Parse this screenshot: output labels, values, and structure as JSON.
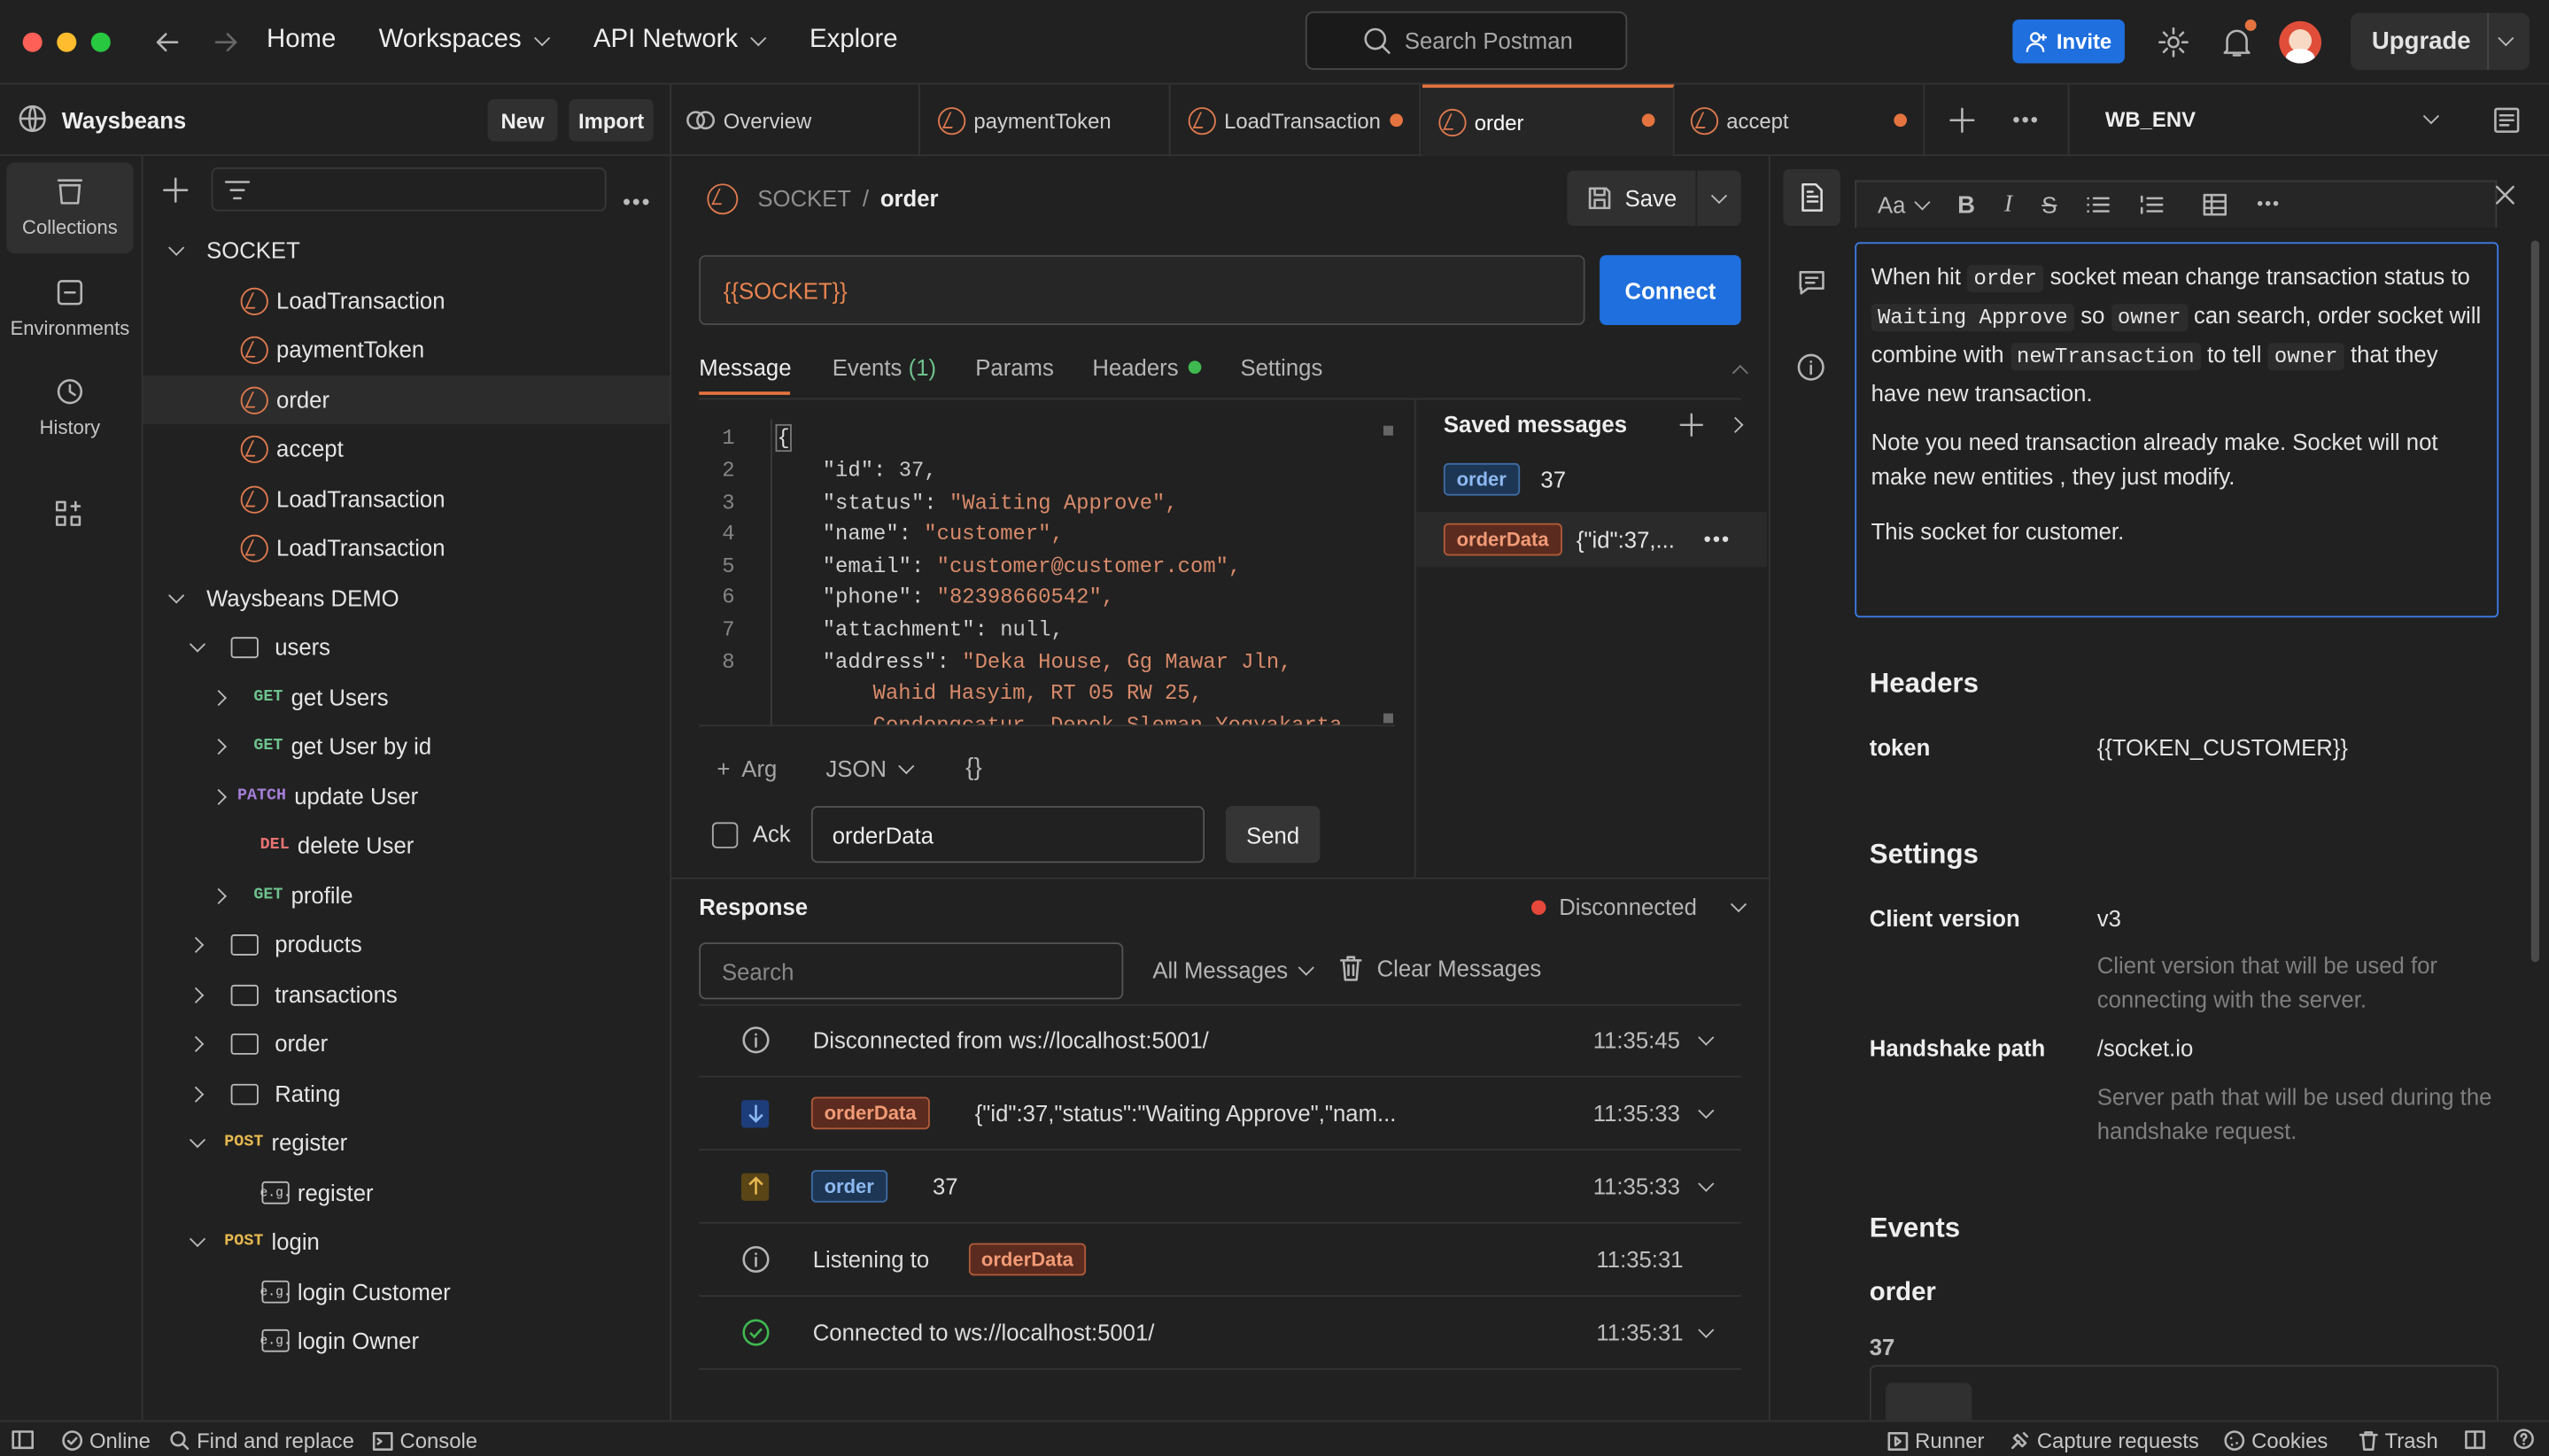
{
  "topbar": {
    "home": "Home",
    "workspaces": "Workspaces",
    "api_network": "API Network",
    "explore": "Explore",
    "search_placeholder": "Search Postman",
    "invite": "Invite",
    "upgrade": "Upgrade"
  },
  "sidebar": {
    "workspace": "Waysbeans",
    "new": "New",
    "import": "Import",
    "rail": [
      "Collections",
      "Environments",
      "History"
    ],
    "items": [
      "SOCKET",
      "LoadTransaction",
      "paymentToken",
      "order",
      "accept",
      "LoadTransaction",
      "LoadTransaction",
      "Waysbeans DEMO",
      "users",
      "get Users",
      "get User by id",
      "update User",
      "delete User",
      "profile",
      "products",
      "transactions",
      "order",
      "Rating",
      "register",
      "register",
      "login",
      "login Customer",
      "login Owner"
    ],
    "methods": {
      "get": "GET",
      "patch": "PATCH",
      "del": "DEL",
      "post": "POST"
    }
  },
  "tabs": [
    "Overview",
    "paymentToken",
    "LoadTransaction",
    "order",
    "accept"
  ],
  "env": "WB_ENV",
  "request": {
    "breadcrumb_root": "SOCKET",
    "breadcrumb_sep": "/",
    "breadcrumb_name": "order",
    "save": "Save",
    "url": "{{SOCKET}}",
    "connect": "Connect",
    "subtabs": [
      "Message",
      "Events",
      "(1)",
      "Params",
      "Headers",
      "Settings"
    ],
    "code": [
      {
        "n": "1",
        "t": "{"
      },
      {
        "n": "2",
        "k": "\"id\"",
        "v": "37,"
      },
      {
        "n": "3",
        "k": "\"status\"",
        "v": "\"Waiting Approve\","
      },
      {
        "n": "4",
        "k": "\"name\"",
        "v": "\"customer\","
      },
      {
        "n": "5",
        "k": "\"email\"",
        "v": "\"customer@customer.com\","
      },
      {
        "n": "6",
        "k": "\"phone\"",
        "v": "\"82398660542\","
      },
      {
        "n": "7",
        "k": "\"attachment\"",
        "v": "null,"
      },
      {
        "n": "8",
        "k": "\"address\"",
        "v": "\"Deka House, Gg Mawar Jln,"
      },
      {
        "n": "",
        "k": "",
        "v": "Wahid Hasyim, RT 05 RW 25,"
      },
      {
        "n": "",
        "k": "",
        "v": "Condongcatur, Depok Sleman Yogyakarta"
      }
    ],
    "arg": "Arg",
    "format": "JSON",
    "braces": "{}",
    "ack": "Ack",
    "event_name": "orderData",
    "send": "Send",
    "saved_title": "Saved messages",
    "saved": [
      {
        "tag": "order",
        "val": "37"
      },
      {
        "tag": "orderData",
        "val": "{\"id\":37,..."
      }
    ]
  },
  "response": {
    "title": "Response",
    "status": "Disconnected",
    "search_placeholder": "Search",
    "filter": "All Messages",
    "clear": "Clear Messages",
    "rows": [
      {
        "text": "Disconnected from ws://localhost:5001/",
        "time": "11:35:45"
      },
      {
        "tag": "orderData",
        "text": "{\"id\":37,\"status\":\"Waiting Approve\",\"nam...",
        "time": "11:35:33"
      },
      {
        "tag": "order",
        "text": "37",
        "time": "11:35:33"
      },
      {
        "pre": "Listening to",
        "tag": "orderData",
        "time": "11:35:31"
      },
      {
        "text": "Connected to ws://localhost:5001/",
        "time": "11:35:31"
      }
    ]
  },
  "docs": {
    "toolbar_font": "Aa",
    "p1": [
      "When hit",
      "order",
      "socket mean change transaction status to",
      "Waiting Approve",
      "so",
      "owner",
      "can search, order socket will combine with",
      "newTransaction",
      "to tell",
      "owner",
      "that they have new transaction."
    ],
    "p2": "Note you need transaction already make. Socket will not make new entities , they just modify.",
    "p3": "This socket for customer.",
    "headers_title": "Headers",
    "header_key": "token",
    "header_val": "{{TOKEN_CUSTOMER}}",
    "settings_title": "Settings",
    "client_version_label": "Client version",
    "client_version": "v3",
    "client_version_desc": "Client version that will be used for connecting with the server.",
    "handshake_label": "Handshake path",
    "handshake": "/socket.io",
    "handshake_desc": "Server path that will be used during the handshake request.",
    "events_title": "Events",
    "event": "order",
    "event_val": "37"
  },
  "statusbar": {
    "online": "Online",
    "find": "Find and replace",
    "console": "Console",
    "runner": "Runner",
    "capture": "Capture requests",
    "cookies": "Cookies",
    "trash": "Trash"
  }
}
